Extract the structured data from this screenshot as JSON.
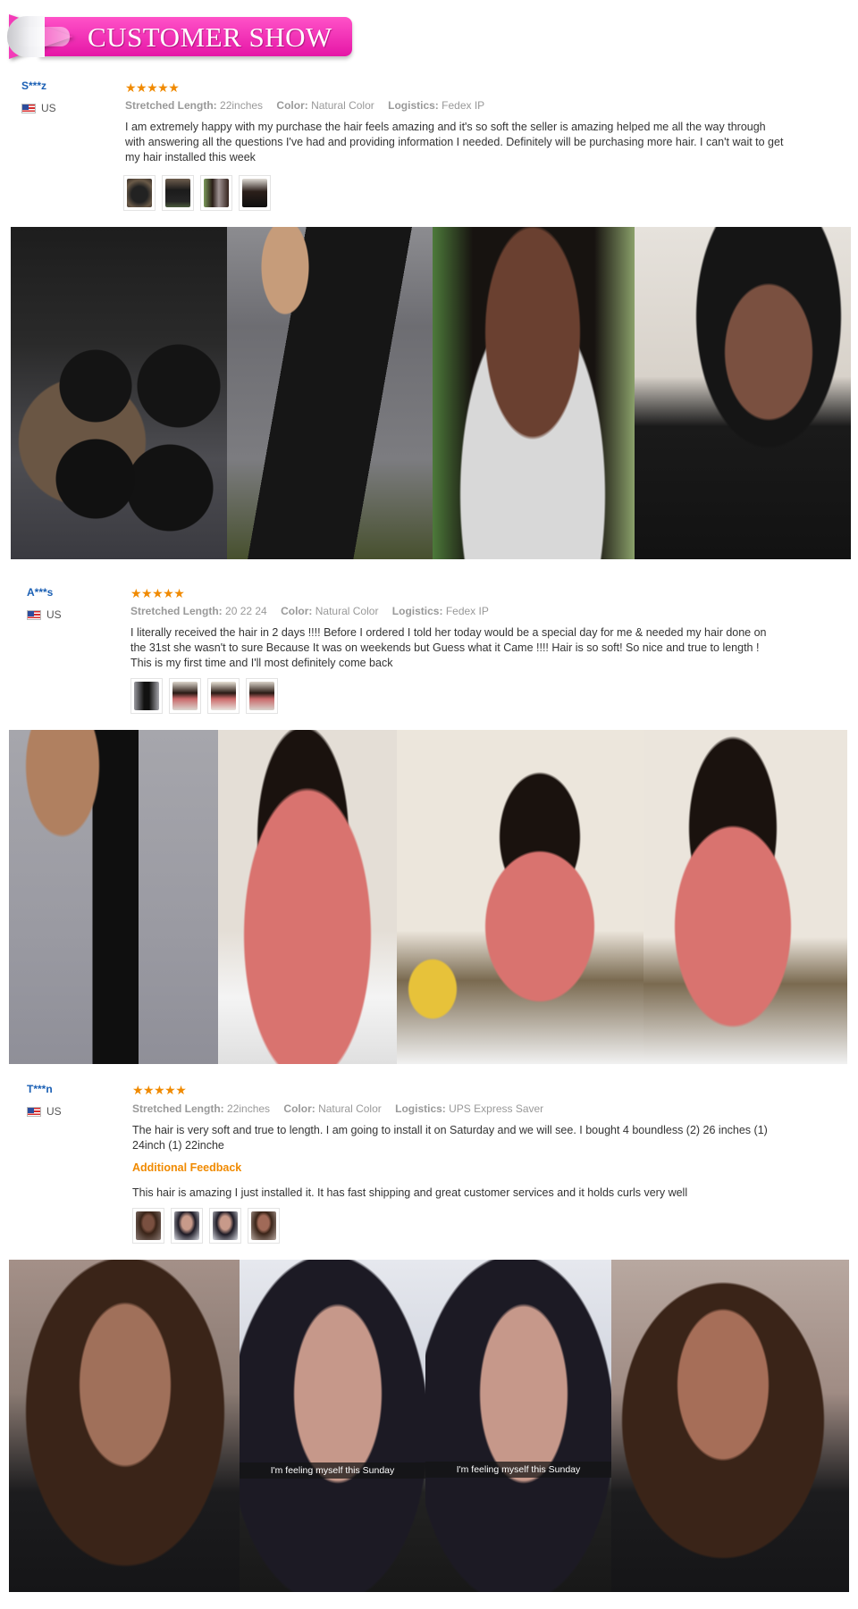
{
  "banner": {
    "title": "CUSTOMER SHOW"
  },
  "labels": {
    "stretched_length": "Stretched Length:",
    "color": "Color:",
    "logistics": "Logistics:"
  },
  "reviews": [
    {
      "username": "S***z",
      "country": "US",
      "stars": "★★★★★",
      "stretched_length": "22inches",
      "color": "Natural Color",
      "logistics": "Fedex IP",
      "text": "I am extremely happy with my purchase the hair feels amazing and it's so soft the seller is amazing helped me all the way through with answering all the questions I've had and providing information I needed. Definitely will be purchasing more hair. I can't wait to get my hair installed this week"
    },
    {
      "username": "A***s",
      "country": "US",
      "stars": "★★★★★",
      "stretched_length": "20 22 24",
      "color": "Natural Color",
      "logistics": "Fedex IP",
      "text": "I literally received the hair in 2 days !!!! Before I ordered I told her today would be a special day for me & needed my hair done on the 31st she wasn't to sure Because It was on weekends but Guess what it Came !!!! Hair is so soft! So nice and true to length ! This is my first time and I'll most definitely come back"
    },
    {
      "username": "T***n",
      "country": "US",
      "stars": "★★★★★",
      "stretched_length": "22inches",
      "color": "Natural Color",
      "logistics": "UPS Express Saver",
      "text": "The hair is very soft and true to length. I am going to install it on Saturday and we will see. I bought 4 boundless (2) 26 inches (1) 24inch (1) 22inche",
      "additional_label": "Additional Feedback",
      "additional_text": "This hair is amazing I just installed it. It has fast shipping and great customer services and it holds curls very well"
    }
  ],
  "captions": {
    "snap_1": "I'm feeling myself this Sunday",
    "snap_2": "I'm feeling myself this Sunday"
  },
  "colors": {
    "banner_pink": "#f33bb8",
    "username_blue": "#1a5fb4",
    "star_orange": "#f08a00",
    "meta_gray": "#999999"
  }
}
